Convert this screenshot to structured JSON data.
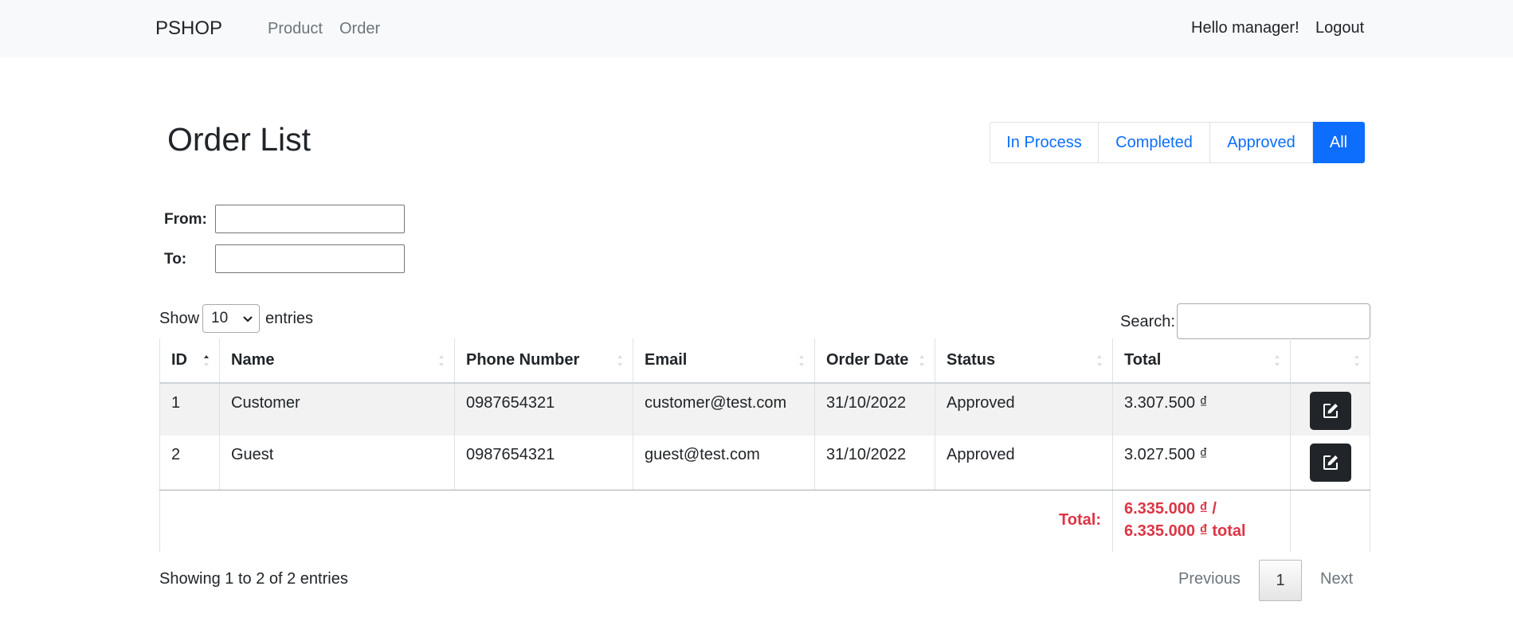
{
  "navbar": {
    "brand": "PSHOP",
    "links": [
      "Product",
      "Order"
    ],
    "greeting": "Hello manager!",
    "logout": "Logout"
  },
  "page": {
    "title": "Order List",
    "filters": [
      "In Process",
      "Completed",
      "Approved",
      "All"
    ],
    "active_filter": "All",
    "date_from_label": "From:",
    "date_to_label": "To:"
  },
  "datatable": {
    "show_label": "Show",
    "entries_label": "entries",
    "page_length": "10",
    "search_label": "Search:",
    "search_value": "",
    "columns": [
      "ID",
      "Name",
      "Phone Number",
      "Email",
      "Order Date",
      "Status",
      "Total",
      ""
    ],
    "rows": [
      {
        "id": "1",
        "name": "Customer",
        "phone": "0987654321",
        "email": "customer@test.com",
        "date": "31/10/2022",
        "status": "Approved",
        "total": "3.307.500 ₫"
      },
      {
        "id": "2",
        "name": "Guest",
        "phone": "0987654321",
        "email": "guest@test.com",
        "date": "31/10/2022",
        "status": "Approved",
        "total": "3.027.500 ₫"
      }
    ],
    "footer": {
      "label": "Total:",
      "line1": "6.335.000 ₫ /",
      "line2": "6.335.000 ₫ total"
    },
    "info": "Showing 1 to 2 of 2 entries",
    "pagination": {
      "previous": "Previous",
      "current": "1",
      "next": "Next"
    }
  },
  "icons": {
    "edit": "edit-icon",
    "sort": "sort-icon",
    "dropdown": "chevron-down-icon"
  },
  "colors": {
    "accent": "#0d6efd",
    "danger": "#dc3545",
    "dark_button": "#212529",
    "navbar_bg": "#f8f9fa"
  }
}
